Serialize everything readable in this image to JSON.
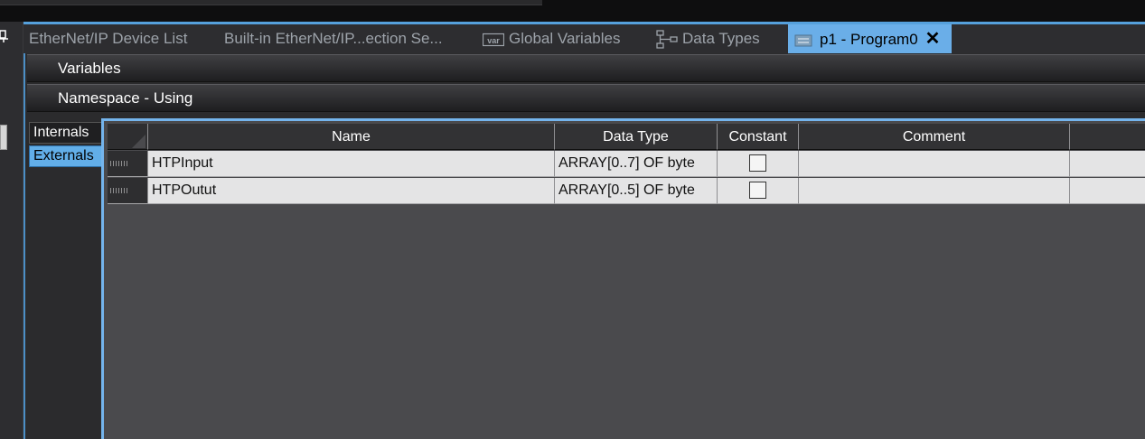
{
  "tabs": [
    {
      "label": "EtherNet/IP Device List",
      "icon": null
    },
    {
      "label": "Built-in EtherNet/IP...ection Se...",
      "icon": null
    },
    {
      "label": "Global Variables",
      "icon": "var-icon"
    },
    {
      "label": "Data Types",
      "icon": "data-types-icon"
    },
    {
      "label": "p1 - Program0",
      "icon": "program-icon",
      "active": true
    }
  ],
  "sections": {
    "variables": "Variables",
    "namespace": "Namespace - Using"
  },
  "inner_tabs": {
    "internals": "Internals",
    "externals": "Externals"
  },
  "table": {
    "columns": [
      "Name",
      "Data Type",
      "Constant",
      "Comment"
    ],
    "rows": [
      {
        "name": "HTPInput",
        "data_type": "ARRAY[0..7] OF byte",
        "constant": false,
        "comment": ""
      },
      {
        "name": "HTPOutut",
        "data_type": "ARRAY[0..5] OF byte",
        "constant": false,
        "comment": ""
      }
    ]
  },
  "colors": {
    "accent": "#6aaee8",
    "background": "#2b2b2d",
    "grid_background": "#4a4a4d"
  }
}
